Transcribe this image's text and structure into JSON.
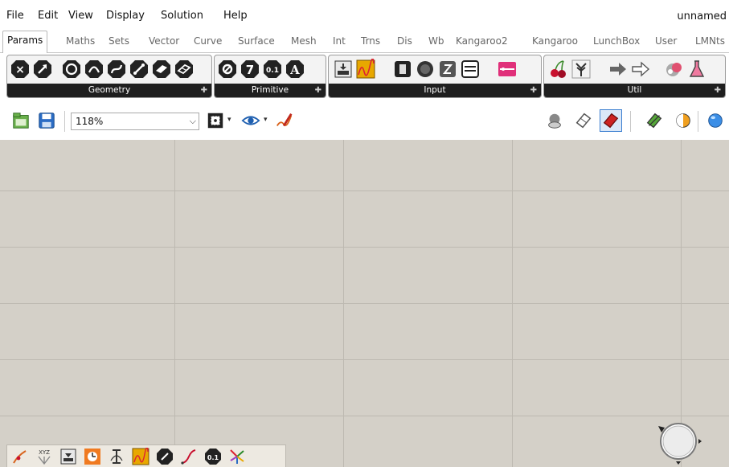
{
  "menu": {
    "items": [
      "File",
      "Edit",
      "View",
      "Display",
      "Solution",
      "Help"
    ],
    "document_name": "unnamed"
  },
  "tabs": [
    "Params",
    "Maths",
    "Sets",
    "Vector",
    "Curve",
    "Surface",
    "Mesh",
    "Int",
    "Trns",
    "Dis",
    "Wb",
    "Kangaroo2",
    "Kangaroo",
    "LunchBox",
    "User",
    "LMNts"
  ],
  "active_tab": "Params",
  "ribbon": {
    "panels": [
      {
        "label": "Geometry",
        "icons": [
          "point-param-icon",
          "vector-param-icon",
          "circle-param-icon",
          "arc-param-icon",
          "curve-param-icon",
          "line-param-icon",
          "plane-param-icon"
        ]
      },
      {
        "label": "Primitive",
        "icons": [
          "boolean-param-icon",
          "integer-param-icon",
          "number-param-icon",
          "text-param-icon"
        ]
      },
      {
        "label": "Input",
        "icons": [
          "data-input-icon",
          "graph-mapper-icon",
          "button-icon",
          "boolean-toggle-icon",
          "number-slider-icon",
          "value-list-icon",
          "control-knob-icon"
        ]
      },
      {
        "label": "Util",
        "icons": [
          "cherry-icon",
          "tree-icon",
          "relay-arrow-icon",
          "outline-arrow-icon",
          "cluster-icon",
          "flask-icon"
        ]
      }
    ],
    "pin_glyph": "✚"
  },
  "canvas_toolbar": {
    "zoom": "118%",
    "icons": [
      "open-file-icon",
      "save-file-icon",
      "zoom-extents-icon",
      "preview-eye-icon",
      "sketch-pen-icon",
      "preview-off-icon",
      "wireframe-preview-icon",
      "shaded-preview-icon",
      "selected-preview-icon",
      "mesh-settings-icon",
      "sphere-icon"
    ]
  },
  "quickbar": {
    "icons": [
      "point-on-curve-icon",
      "xyz-vector-icon",
      "data-input-icon",
      "timer-icon",
      "curve-icon",
      "graph-mapper-icon",
      "line-param-icon",
      "curve-param-icon",
      "number-param-icon",
      "star-icon"
    ]
  },
  "colors": {
    "canvas": "#d4d0c8",
    "grid": "#bdb9b1",
    "panel_label_bg": "#1f1f1f",
    "selected_shade": "#cc2222",
    "graph_yellow": "#e8a800"
  }
}
